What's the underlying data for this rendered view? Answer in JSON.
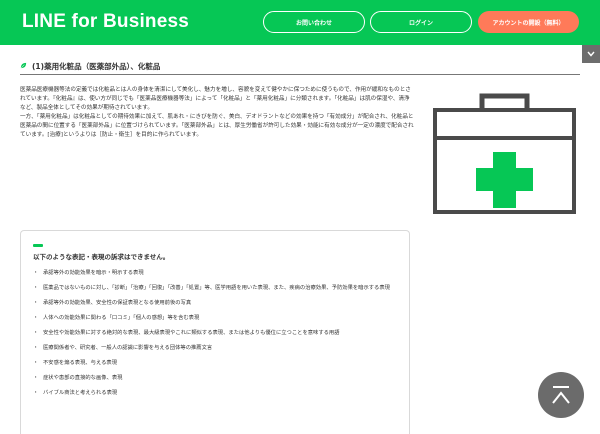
{
  "header": {
    "logo": "LINE for Business",
    "contact_label": "お問い合わせ",
    "login_label": "ログイン",
    "signup_label": "アカウントの開設（無料）"
  },
  "section": {
    "title": "(1)薬用化粧品（医薬部外品）、化粧品",
    "paragraphs": [
      "医薬品医療機器等法の定義では化粧品とは人の身体を清潔にして美化し、魅力を増し、容貌を変えて健やかに保つために使うもので、作用が緩和なものとされています。『化粧品』は、使い方が同じでも「医薬品医療機器等法」によって「化粧品」と「薬用化粧品」に分類されます。「化粧品」は肌の保湿や、清浄など、製品全体としてその効果が期待されています。",
      "一方、「薬用化粧品」は化粧品としての期待効果に加えて、肌あれ・にきびを防ぐ、美白、デオドラントなどの効果を持つ「有効成分」が配合され、化粧品と医薬品の間に位置する「医薬部外品」に位置づけられています。「医薬部外品」とは、厚生労働省が許可した効果・効能に有効な成分が一定の濃度で配合されています。[治療]というよりは［防止・衛生］を目的に作られています。"
    ]
  },
  "notice": {
    "title": "以下のような表記・表現の訴求はできません。",
    "items": [
      "承認等外の効能効果を暗示・明示する表現",
      "医薬品ではないものに対し、「診断」「治療」「回復」「改善」「処置」等、医学用語を用いた表現、また、疾病の治療効果、予防効果を暗示する表現",
      "承認等外の効能効果、安全性の保証表現となる使用前後の写真",
      "人体への効能効果に関わる「口コミ」「個人の感想」等を含む表現",
      "安全性や効能効果に対する絶対的な表現、最大級表現やこれに類似する表現、または他よりも優位に立つことを意味する用語",
      "医療関係者や、研究者、一般人の認識に影響を与える団体等の推薦文言",
      "不安感を煽る表現、与える表現",
      "症状や患部の直接的な画像、表現",
      "バイブル商法と考えられる表現"
    ]
  },
  "colors": {
    "brand_green": "#06c755",
    "signup_orange": "#ff7a59",
    "icon_gray": "#6b6b6b"
  },
  "icons": {
    "kit": "first-aid-kit-icon",
    "scroll_top": "arrow-up-icon",
    "collapse": "chevron-down-icon",
    "section_leaf": "leaf-icon"
  }
}
